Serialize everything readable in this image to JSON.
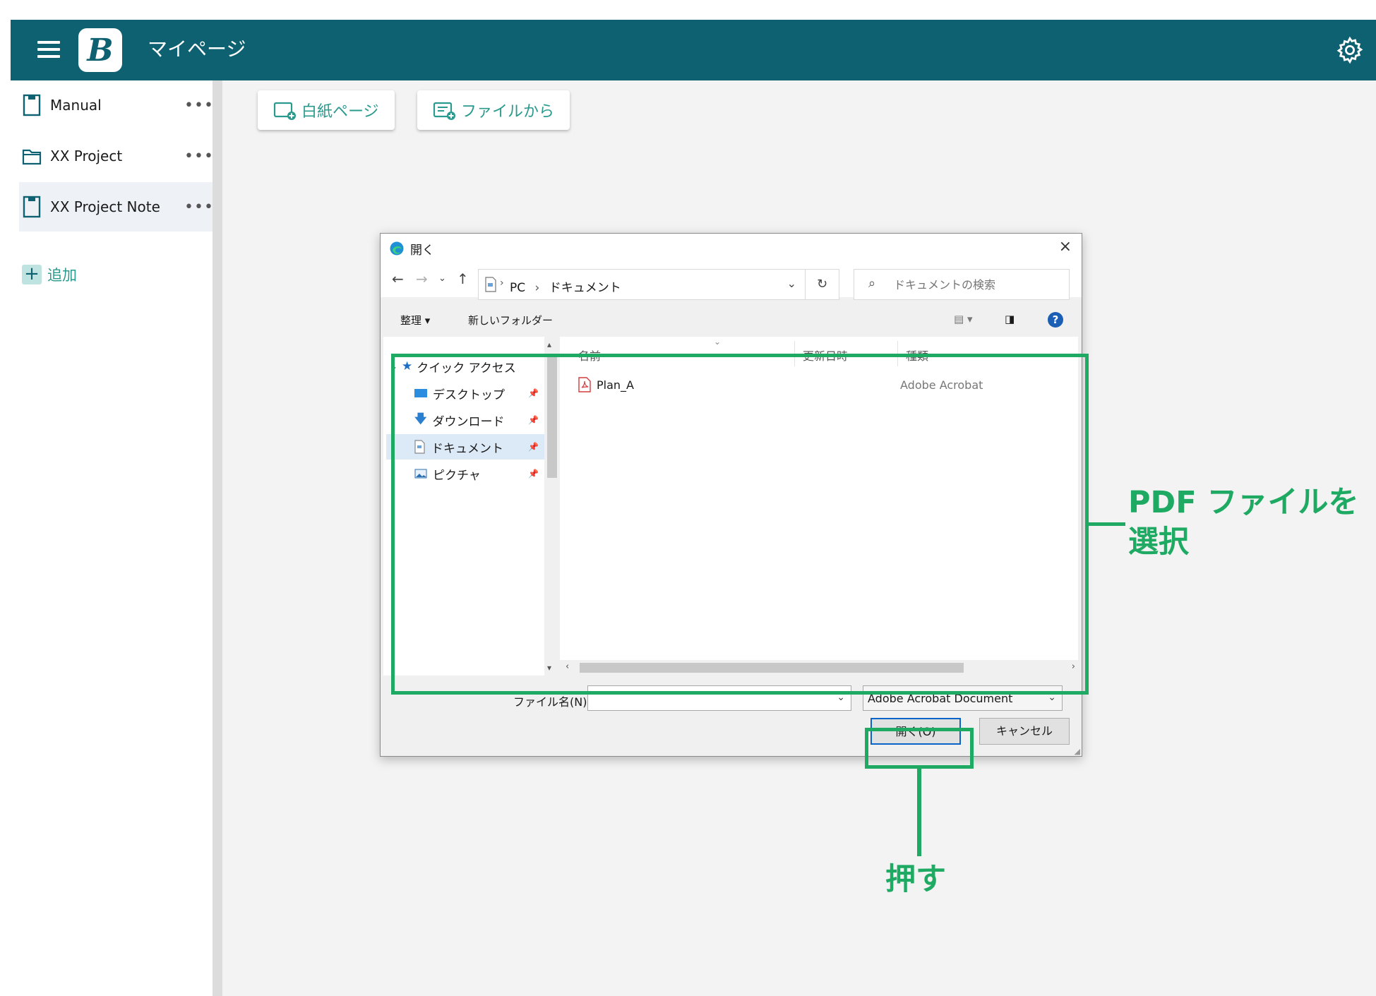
{
  "header": {
    "title": "マイページ",
    "logo_letter": "B"
  },
  "sidebar": {
    "items": [
      {
        "label": "Manual",
        "icon": "notebook-icon",
        "more": "•••"
      },
      {
        "label": "XX Project",
        "icon": "folder-icon",
        "more": "•••"
      },
      {
        "label": "XX Project Note",
        "icon": "notebook-icon",
        "more": "•••",
        "active": true
      }
    ],
    "add_label": "追加"
  },
  "toolbar": {
    "blank_page_label": "白紙ページ",
    "from_file_label": "ファイルから"
  },
  "dialog": {
    "title": "開く",
    "close": "×",
    "path": [
      "PC",
      "ドキュメント"
    ],
    "search_placeholder": "ドキュメントの検索",
    "organize_label": "整理 ▾",
    "new_folder_label": "新しいフォルダー",
    "tree": {
      "quick_access": "クイック アクセス",
      "items": [
        {
          "label": "デスクトップ",
          "icon": "desktop-icon"
        },
        {
          "label": "ダウンロード",
          "icon": "download-icon"
        },
        {
          "label": "ドキュメント",
          "icon": "document-icon",
          "selected": true
        },
        {
          "label": "ピクチャ",
          "icon": "picture-icon"
        }
      ]
    },
    "columns": {
      "name": "名前",
      "modified": "更新日時",
      "type": "種類"
    },
    "files": [
      {
        "name": "Plan_A",
        "type": "Adobe Acrobat",
        "icon": "pdf-icon"
      }
    ],
    "filename_label": "ファイル名(N):",
    "filename_value": "",
    "filetype_value": "Adobe Acrobat Document",
    "open_button": "開く(O)",
    "cancel_button": "キャンセル"
  },
  "annotations": {
    "select_pdf_line1": "PDF ファイルを",
    "select_pdf_line2": "選択",
    "press": "押す",
    "color": "#1faa63"
  },
  "colors": {
    "header_bg": "#0d6170",
    "accent": "#2a9a8e"
  }
}
